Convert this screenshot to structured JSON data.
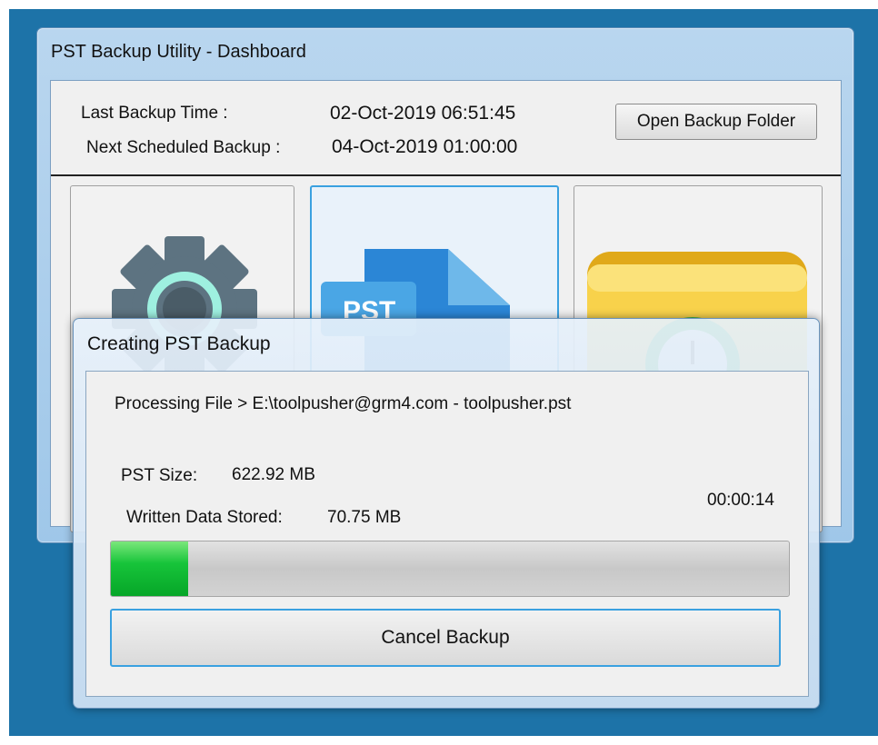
{
  "main_window": {
    "title": "PST Backup Utility - Dashboard",
    "last_backup_label": "Last Backup Time :",
    "last_backup_value": "02-Oct-2019 06:51:45",
    "next_backup_label": "Next Scheduled Backup :",
    "next_backup_value": "04-Oct-2019 01:00:00",
    "open_folder_button": "Open Backup Folder",
    "tiles": [
      {
        "icon": "gear-icon"
      },
      {
        "icon": "pst-file-icon",
        "badge": "PST"
      },
      {
        "icon": "folder-clock-icon"
      }
    ]
  },
  "dialog": {
    "title": "Creating PST Backup",
    "processing_text": "Processing File > E:\\toolpusher@grm4.com - toolpusher.pst",
    "pst_size_label": "PST Size:",
    "pst_size_value": "622.92 MB",
    "written_label": "Written Data Stored:",
    "written_value": "70.75 MB",
    "elapsed_time": "00:00:14",
    "progress_fraction": 0.1136,
    "cancel_button": "Cancel Backup"
  },
  "colors": {
    "desktop": "#1d73a8",
    "accent_border": "#3aa1e0",
    "progress_green": "#17c43a"
  }
}
